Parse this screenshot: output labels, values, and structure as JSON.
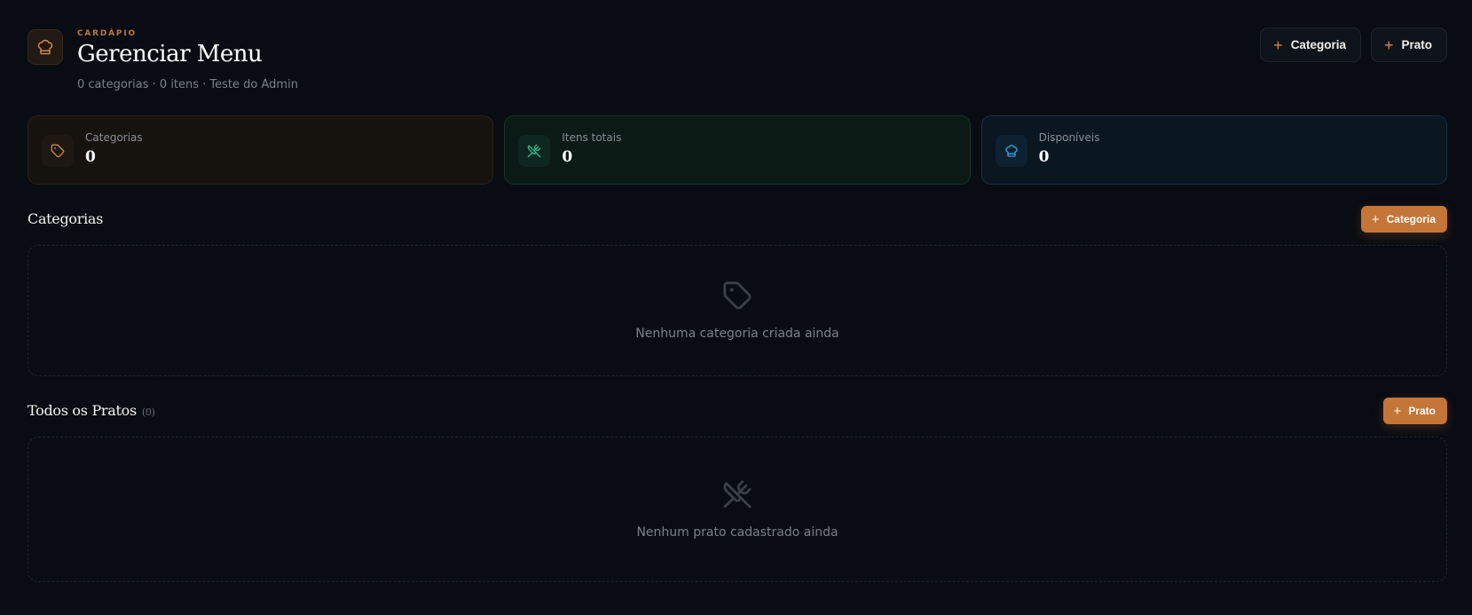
{
  "header": {
    "eyebrow": "CARDÁPIO",
    "title": "Gerenciar Menu",
    "subtitle": "0 categorias · 0 itens · Teste do Admin",
    "actions": [
      {
        "label": "Categoria",
        "icon": "plus-icon"
      },
      {
        "label": "Prato",
        "icon": "plus-icon"
      }
    ],
    "logo_icon": "chef-hat-icon"
  },
  "stats": [
    {
      "label": "Categorias",
      "value": "0",
      "icon": "tag-icon",
      "accent": "#d2874a"
    },
    {
      "label": "Itens totais",
      "value": "0",
      "icon": "utensils-crossed-icon",
      "accent": "#2fbf8a"
    },
    {
      "label": "Disponíveis",
      "value": "0",
      "icon": "chef-hat-icon",
      "accent": "#3aa0e0"
    }
  ],
  "categories_section": {
    "title": "Categorias",
    "add_label": "Categoria",
    "empty_icon": "tag-icon",
    "empty_text": "Nenhuma categoria criada ainda"
  },
  "dishes_section": {
    "title": "Todos os Pratos",
    "count": "(0)",
    "add_label": "Prato",
    "empty_icon": "utensils-crossed-icon",
    "empty_text": "Nenhum prato cadastrado ainda"
  },
  "colors": {
    "background": "#090c13",
    "accent": "#c47538",
    "green": "#2fbf8a",
    "blue": "#3aa0e0"
  }
}
